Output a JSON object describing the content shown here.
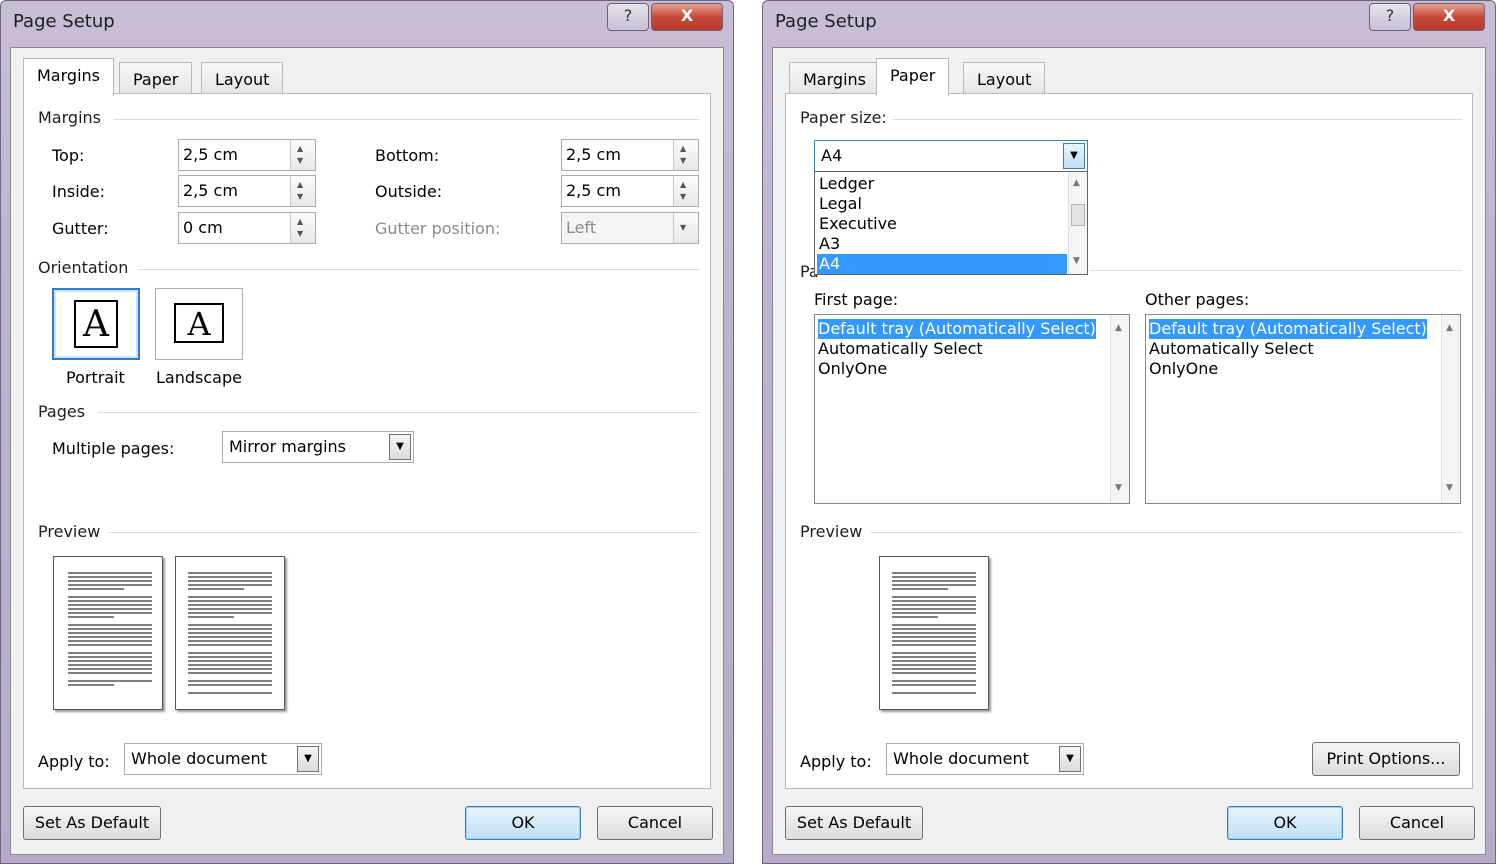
{
  "left_dialog": {
    "title": "Page Setup",
    "help_label": "?",
    "close_label": "X",
    "tabs": [
      "Margins",
      "Paper",
      "Layout"
    ],
    "margins_group": "Margins",
    "fields": {
      "top_label": "Top:",
      "top_value": "2,5 cm",
      "inside_label": "Inside:",
      "inside_value": "2,5 cm",
      "gutter_label": "Gutter:",
      "gutter_value": "0 cm",
      "bottom_label": "Bottom:",
      "bottom_value": "2,5 cm",
      "outside_label": "Outside:",
      "outside_value": "2,5 cm",
      "gutter_position_label": "Gutter position:",
      "gutter_position_value": "Left"
    },
    "orientation_group": "Orientation",
    "portrait_label": "Portrait",
    "landscape_label": "Landscape",
    "icon_letter": "A",
    "pages_group": "Pages",
    "multiple_pages_label": "Multiple pages:",
    "multiple_pages_value": "Mirror margins",
    "preview_group": "Preview",
    "apply_to_label": "Apply to:",
    "apply_to_value": "Whole document",
    "set_default_label": "Set As Default",
    "ok_label": "OK",
    "cancel_label": "Cancel"
  },
  "right_dialog": {
    "title": "Page Setup",
    "help_label": "?",
    "close_label": "X",
    "tabs": [
      "Margins",
      "Paper",
      "Layout"
    ],
    "paper_size_label": "Paper size:",
    "paper_size_value": "A4",
    "paper_size_options": [
      "Ledger",
      "Legal",
      "Executive",
      "A3",
      "A4"
    ],
    "paper_source_fragment": "Pa",
    "first_page_label": "First page:",
    "other_pages_label": "Other pages:",
    "first_page_options": [
      "Default tray (Automatically Select)",
      "Automatically Select",
      "OnlyOne"
    ],
    "other_pages_options": [
      "Default tray (Automatically Select)",
      "Automatically Select",
      "OnlyOne"
    ],
    "preview_group": "Preview",
    "apply_to_label": "Apply to:",
    "apply_to_value": "Whole document",
    "print_options_label": "Print Options...",
    "set_default_label": "Set As Default",
    "ok_label": "OK",
    "cancel_label": "Cancel"
  }
}
